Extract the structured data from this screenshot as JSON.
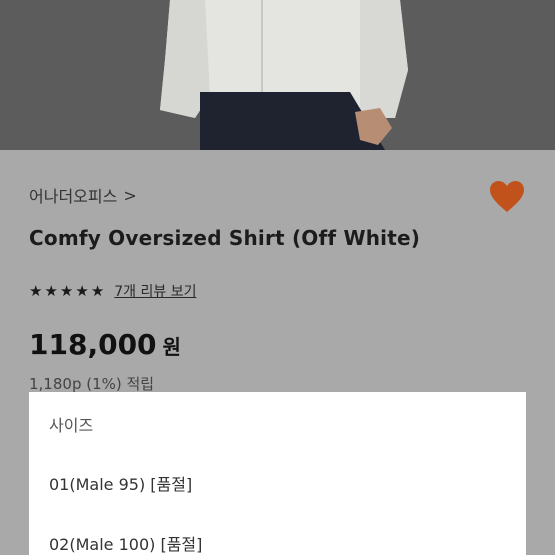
{
  "product": {
    "brand": "어나더오피스",
    "brand_chevron": ">",
    "title": "Comfy Oversized Shirt (Off White)",
    "rating_stars": 5,
    "review_link": "7개 리뷰 보기",
    "price": "118,000",
    "currency": "원",
    "points": "1,180p (1%) 적립",
    "wishlist_color": "#c1521c"
  },
  "size_dropdown": {
    "header": "사이즈",
    "options": [
      "01(Male 95) [품절]",
      "02(Male 100) [품절]"
    ]
  },
  "icons": {
    "wishlist": "heart-icon",
    "star": "star-icon"
  }
}
